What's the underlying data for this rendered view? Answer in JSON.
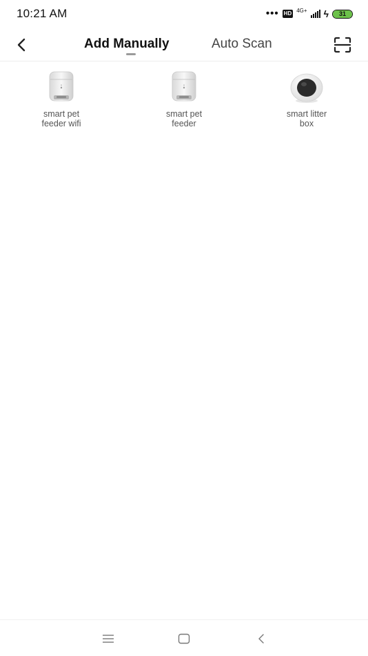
{
  "status_bar": {
    "time": "10:21 AM",
    "dots": "•••",
    "hd_label": "HD",
    "network_label": "4G+",
    "battery_level": "31",
    "battery_color": "#6cc24a"
  },
  "header": {
    "tabs": [
      {
        "label": "Add Manually",
        "active": true
      },
      {
        "label": "Auto Scan",
        "active": false
      }
    ],
    "back_icon": "chevron-left-icon",
    "scan_icon": "scan-frame-icon"
  },
  "devices": [
    {
      "line1": "smart pet",
      "line2": "feeder wifi",
      "icon": "pet-feeder-icon"
    },
    {
      "line1": "smart pet",
      "line2": "feeder",
      "icon": "pet-feeder-icon"
    },
    {
      "line1": "smart litter",
      "line2": "box",
      "icon": "litter-box-icon"
    }
  ],
  "nav_bar": {
    "items": [
      "menu-icon",
      "home-icon",
      "back-icon"
    ]
  }
}
